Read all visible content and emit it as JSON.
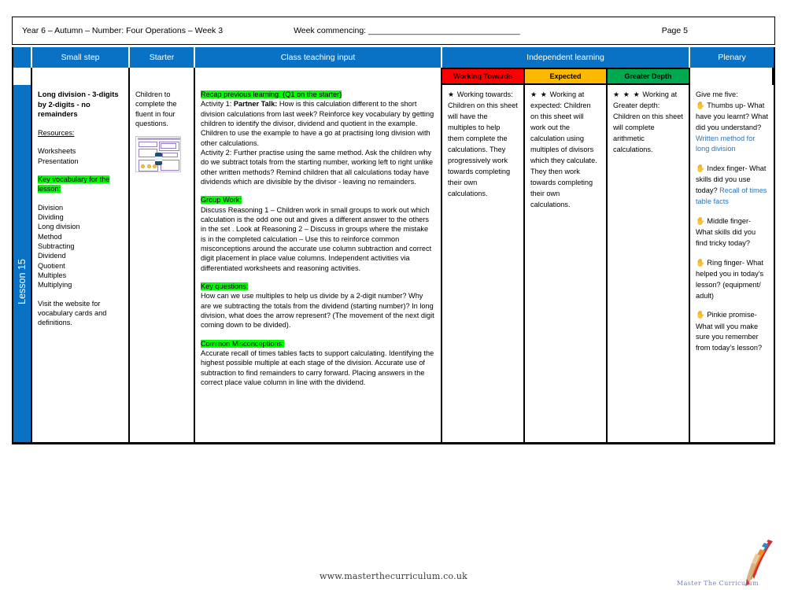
{
  "header": {
    "unit_title": "Year 6 – Autumn – Number: Four Operations – Week 3",
    "week_commencing": "Week commencing: _________________________________",
    "page_label": "Page 5"
  },
  "columns": {
    "small_step": "Small step",
    "starter": "Starter",
    "class_teaching_input": "Class teaching input",
    "independent_learning": "Independent learning",
    "plenary": "Plenary"
  },
  "independent_headers": {
    "working_towards": "Working Towards",
    "expected": "Expected",
    "greater_depth": "Greater Depth"
  },
  "colors": {
    "header_blue": "#0a72c4",
    "working_towards_red": "#ff0000",
    "expected_amber": "#fcb900",
    "greater_depth_green": "#00a94f",
    "highlight_green": "#00ff00",
    "answer_blue": "#2e74b5"
  },
  "lesson_spine": "Lesson 15",
  "small_step": {
    "title": "Long division - 3-digits by 2-digits - no remainders",
    "resources_heading": "Resources:",
    "resources": [
      "Worksheets",
      "Presentation"
    ],
    "vocab_heading": "Key vocabulary for the lesson:",
    "vocabulary": [
      "Division",
      "Dividing",
      "Long division",
      "Method",
      "Subtracting",
      "Dividend",
      "Quotient",
      "Multiples",
      "Multiplying"
    ],
    "note": "Visit the website for vocabulary cards and definitions."
  },
  "starter": {
    "text": "Children to complete the fluent in four questions.",
    "thumbnail_name": "fluent-in-four-worksheet-thumbnail"
  },
  "class_teaching_input": {
    "recap_tag": "Recap previous learning: (Q1 on the starter)",
    "activity1_label": "Activity 1:",
    "activity1_bold": "Partner Talk:",
    "activity1_text": " How is this calculation different to the short division calculations from last week?  Reinforce key vocabulary by getting children to identify the divisor, dividend and quotient in the example. Children to use the example to  have a go at practising long division with other calculations.",
    "activity2_text": "Activity 2: Further practise using the same method. Ask the children why do we subtract totals from the starting number, working left to right unlike other written methods? Remind children that all calculations today have dividends which are divisible by the divisor - leaving no remainders.",
    "group_work_tag": "Group Work:",
    "group_work_text": "Discuss Reasoning 1 – Children work in small groups to work out which calculation is the odd one out and gives a different answer to the others in the set . Look at Reasoning 2 – Discuss in groups where the mistake is in the completed calculation – Use this to reinforce common misconceptions around the accurate use column subtraction and correct digit placement in place value columns. Independent activities via differentiated worksheets and reasoning activities.",
    "key_questions_tag": "Key questions:",
    "key_questions_text": "How can we use multiples to help us divide by a 2-digit number? Why are we subtracting the totals from the dividend (starting number)? In long division, what does the arrow represent? (The movement of the next digit coming down to be divided).",
    "misconceptions_tag": "Common Misconceptions:",
    "misconceptions_text": "Accurate recall of times tables facts to support calculating. Identifying the highest possible multiple at each stage of the division. Accurate use of subtraction to find remainders to carry forward. Placing answers in the correct place value column in line with the dividend."
  },
  "independent_learning": {
    "working_towards": {
      "stars": "★",
      "heading": "Working towards:",
      "text": "Children on this sheet will have the multiples to help them complete the calculations. They progressively work towards completing their own calculations."
    },
    "expected": {
      "stars": "★ ★",
      "heading": "Working at expected:",
      "text": "Children on this sheet will work out the calculation using multiples of divisors which they calculate. They then work towards completing their own calculations."
    },
    "greater_depth": {
      "stars": "★ ★ ★",
      "heading": "Working at Greater depth:",
      "text": "Children on this sheet will complete arithmetic calculations."
    }
  },
  "plenary": {
    "intro": "Give me five:",
    "items": [
      {
        "icon": "hand-icon",
        "question": "Thumbs up- What have you learnt? What did you understand?",
        "answer": "Written method for long division"
      },
      {
        "icon": "hand-icon",
        "question": "Index finger- What skills did you use today?",
        "answer": "Recall of times table facts"
      },
      {
        "icon": "hand-icon",
        "question": "Middle finger- What skills did you find tricky today?",
        "answer": ""
      },
      {
        "icon": "hand-icon",
        "question": "Ring finger- What helped you in today’s lesson? (equipment/ adult)",
        "answer": ""
      },
      {
        "icon": "hand-icon",
        "question": "Pinkie promise- What will you make sure you remember from today’s lesson?",
        "answer": ""
      }
    ]
  },
  "footer": {
    "url": "www.masterthecurriculum.co.uk",
    "logo_text": "Master The Curriculum",
    "logo_name": "pencil-logo"
  }
}
